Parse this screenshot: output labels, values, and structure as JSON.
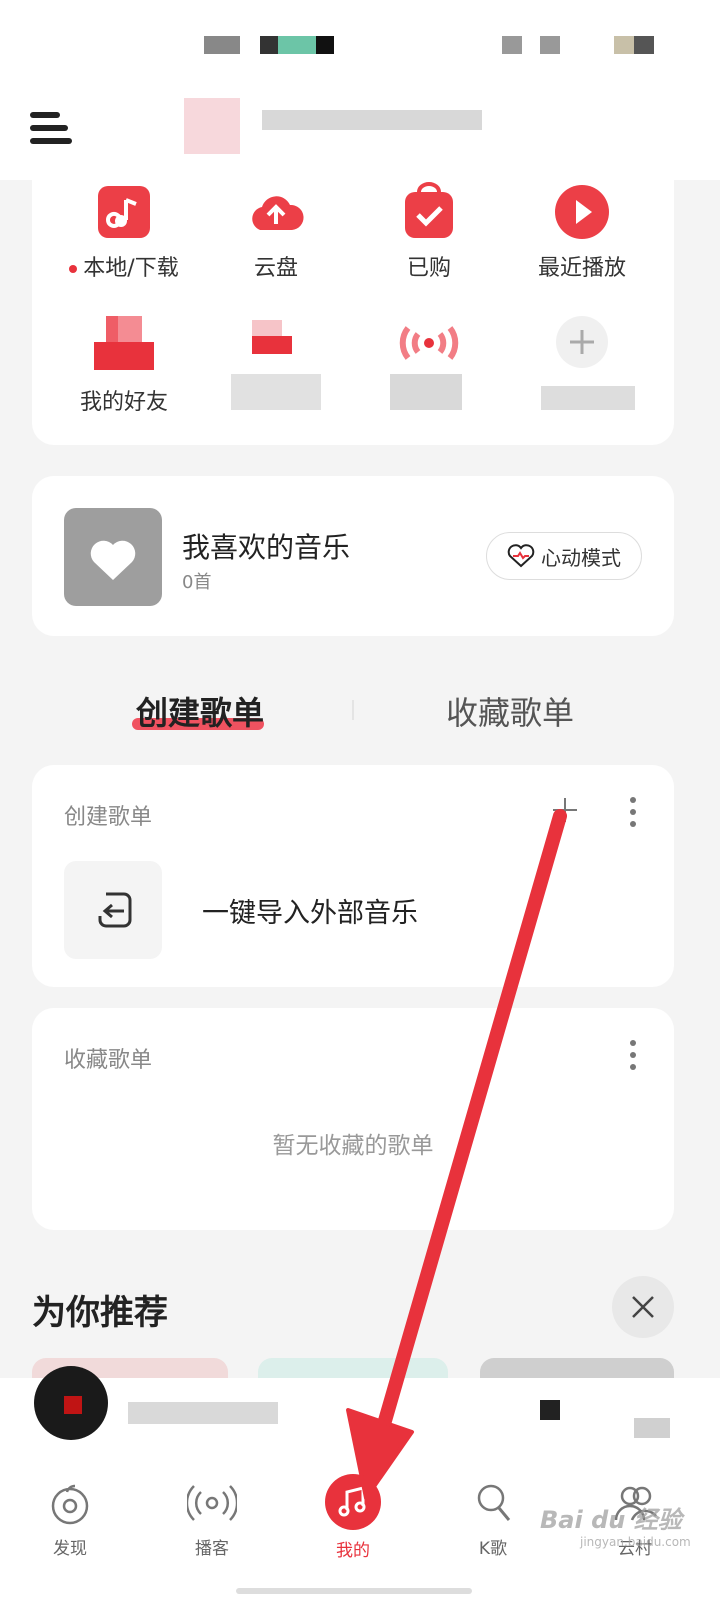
{
  "shortcuts": [
    {
      "label": "本地/下载",
      "icon": "music-note-icon",
      "has_dot": true
    },
    {
      "label": "云盘",
      "icon": "cloud-upload-icon"
    },
    {
      "label": "已购",
      "icon": "purchased-bag-icon"
    },
    {
      "label": "最近播放",
      "icon": "play-icon"
    },
    {
      "label": "我的好友",
      "icon": "friends-icon"
    },
    {
      "label": "",
      "icon": "collection-icon"
    },
    {
      "label": "",
      "icon": "radio-icon"
    },
    {
      "label": "",
      "icon": "add-icon"
    }
  ],
  "liked": {
    "title": "我喜欢的音乐",
    "count": "0首",
    "heart_mode": "心动模式"
  },
  "playlist_tabs": {
    "created": "创建歌单",
    "collected": "收藏歌单"
  },
  "created_section": {
    "title": "创建歌单",
    "import_label": "一键导入外部音乐"
  },
  "collected_section": {
    "title": "收藏歌单",
    "empty_text": "暂无收藏的歌单"
  },
  "recommend": {
    "title": "为你推荐"
  },
  "tabbar": {
    "items": [
      {
        "label": "发现",
        "icon": "discover-icon"
      },
      {
        "label": "播客",
        "icon": "podcast-icon"
      },
      {
        "label": "我的",
        "icon": "music-note-icon",
        "active": true
      },
      {
        "label": "K歌",
        "icon": "microphone-icon"
      },
      {
        "label": "云村",
        "icon": "community-icon"
      }
    ]
  },
  "watermark": {
    "brand": "Bai du 经验",
    "url": "jingyan.baidu.com"
  },
  "colors": {
    "accent": "#e8323c",
    "background": "#f4f4f4",
    "annotation_arrow": "#e8323c"
  }
}
